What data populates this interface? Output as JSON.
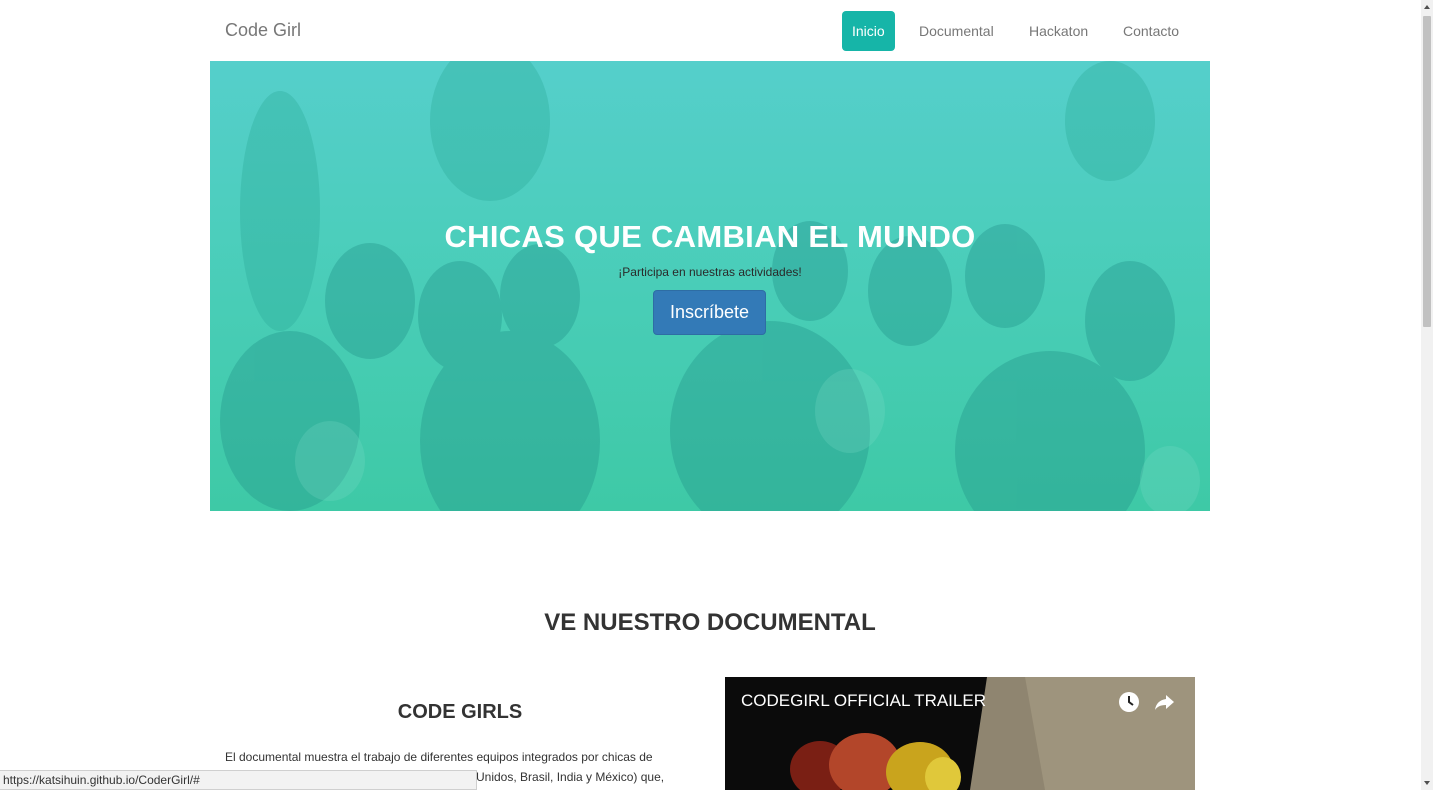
{
  "navbar": {
    "brand": "Code Girl",
    "items": [
      {
        "label": "Inicio",
        "active": true
      },
      {
        "label": "Documental",
        "active": false
      },
      {
        "label": "Hackaton",
        "active": false
      },
      {
        "label": "Contacto",
        "active": false
      }
    ]
  },
  "hero": {
    "title": "CHICAS QUE CAMBIAN EL MUNDO",
    "subtitle": "¡Participa en nuestras actividades!",
    "button": "Inscríbete"
  },
  "documentary": {
    "section_title": "VE NUESTRO DOCUMENTAL",
    "heading": "CODE GIRLS",
    "text_line1": "El documental muestra el trabajo de diferentes equipos integrados por chicas de",
    "text_line2": "Unidos, Brasil, India y México) que,",
    "video": {
      "title": "CODEGIRL OFFICIAL TRAILER",
      "icons": [
        "clock-icon",
        "share-icon"
      ]
    }
  },
  "status_bar": {
    "url": "https://katsihuin.github.io/CoderGirl/#"
  },
  "colors": {
    "accent": "#16b5a8",
    "button": "#337ab7",
    "hero_top": "#55cfcb",
    "hero_bottom": "#3ec9a6"
  }
}
